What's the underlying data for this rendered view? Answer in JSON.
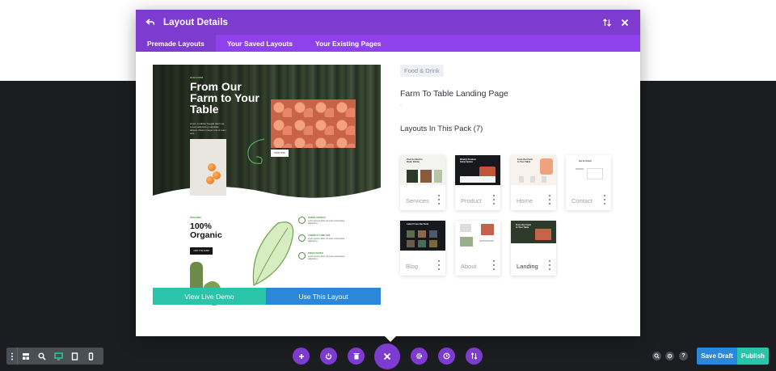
{
  "modal": {
    "title": "Layout Details",
    "tabs": [
      {
        "label": "Premade Layouts",
        "active": true
      },
      {
        "label": "Your Saved Layouts",
        "active": false
      },
      {
        "label": "Your Existing Pages",
        "active": false
      }
    ]
  },
  "preview": {
    "hero_kicker": "OUR FARM",
    "hero_title": "From Our Farm to Your Table",
    "hero_body": "Amet, curabitur feugiat diam vel. Lorem adipiscing vulputate aliquet. Metus integer nisl ut nunc sed.",
    "hero_button": "SHOP NOW",
    "lower_kicker": "ORGANIC",
    "lower_title": "100% Organic",
    "lower_button": "VISIT THE FARM",
    "features": [
      {
        "title": "GREEN GROWTH",
        "text": "Lorem ipsum dolor sit amet consectetur adipiscing"
      },
      {
        "title": "CHEMICAL FREE SOIL",
        "text": "Lorem ipsum dolor sit amet consectetur adipiscing"
      },
      {
        "title": "FRESH WATER",
        "text": "Lorem ipsum dolor sit amet consectetur adipiscing"
      }
    ]
  },
  "actions": {
    "view_demo": "View Live Demo",
    "use_layout": "Use This Layout"
  },
  "details": {
    "category": "Food & Drink",
    "layout_name": "Farm To Table Landing Page",
    "dot": ".",
    "pack_title": "Layouts In This Pack (7)"
  },
  "pack_layouts": [
    {
      "label": "Services",
      "selected": false,
      "mini": "Visit Us Find Us Order Online"
    },
    {
      "label": "Product",
      "selected": false,
      "mini": "Weekly Produce Subscription"
    },
    {
      "label": "Home",
      "selected": false,
      "mini": "From Our Farm to Your Table"
    },
    {
      "label": "Contact",
      "selected": false,
      "mini": "Get In Touch"
    },
    {
      "label": "Blog",
      "selected": false,
      "mini": "Latest From Our Farm"
    },
    {
      "label": "About",
      "selected": false,
      "mini": ""
    },
    {
      "label": "Landing",
      "selected": true,
      "mini": "From Our Farm to Your Table"
    }
  ],
  "toolbar": {
    "save_draft": "Save Draft",
    "publish": "Publish",
    "help": "?"
  },
  "colors": {
    "purple": "#7e3bd0",
    "purple_light": "#8f42ec",
    "teal": "#29c4a9",
    "blue": "#2b87da",
    "dark_bg": "#1b1d20"
  },
  "icons": {
    "header": [
      "back-icon",
      "sort-icon",
      "close-icon"
    ],
    "left_tools": [
      "menu-icon",
      "wireframe-icon",
      "zoom-icon",
      "desktop-icon",
      "tablet-icon",
      "phone-icon"
    ],
    "center_tools": [
      "add-icon",
      "power-icon",
      "trash-icon",
      "close-icon",
      "settings-icon",
      "history-icon",
      "portability-icon"
    ],
    "right_tools": [
      "search-icon",
      "layers-icon",
      "help-icon"
    ]
  }
}
